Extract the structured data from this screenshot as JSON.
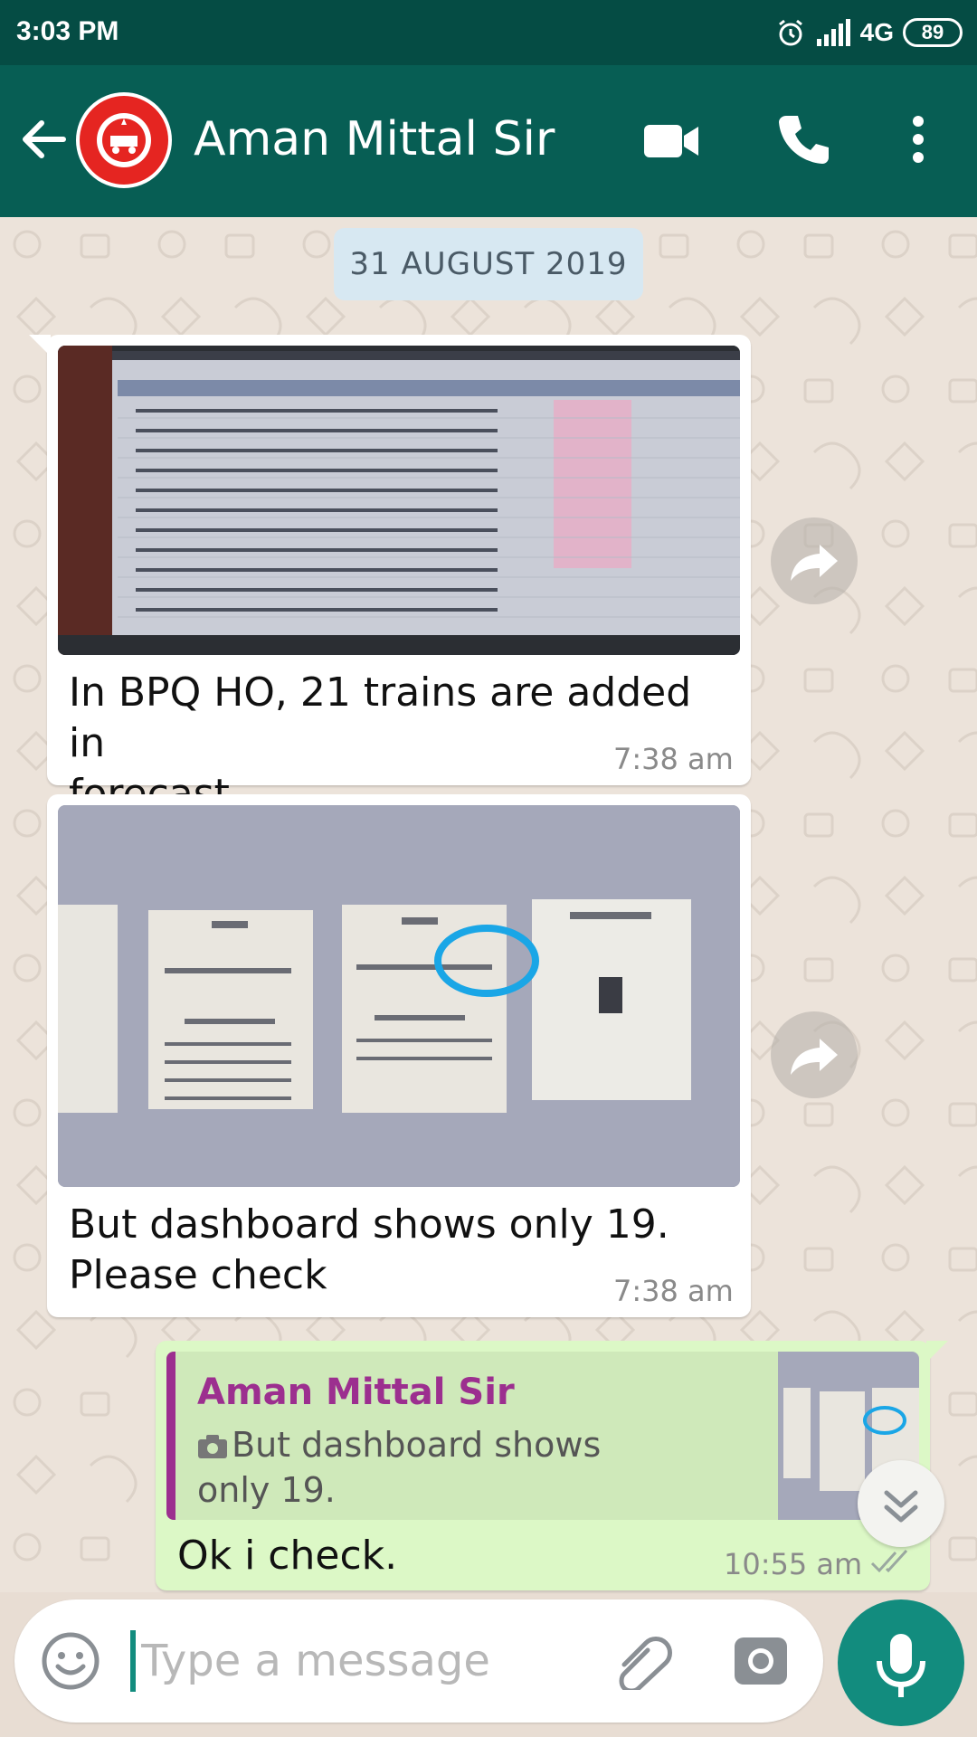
{
  "status_bar": {
    "time": "3:03 PM",
    "network": "4G",
    "battery": "89",
    "icons": [
      "alarm-icon",
      "signal-icon",
      "battery-icon"
    ]
  },
  "header": {
    "contact_name": "Aman Mittal Sir",
    "avatar_icon": "indian-railways-logo",
    "avatar_logo_text": "INDIAN RAILWAYS",
    "icons": [
      "back-arrow-icon",
      "video-call-icon",
      "phone-icon",
      "more-vert-icon"
    ]
  },
  "chat": {
    "date_divider": "31 AUGUST 2019",
    "messages": [
      {
        "direction": "incoming",
        "type": "image",
        "caption": "In BPQ HO, 21 trains are added in forecast",
        "caption_lines": [
          "In BPQ HO, 21 trains are added in",
          "forecast"
        ],
        "time": "7:38 am"
      },
      {
        "direction": "incoming",
        "type": "image",
        "caption": "But dashboard shows only 19. Please check",
        "caption_lines": [
          "But dashboard shows only 19.",
          "Please check"
        ],
        "time": "7:38 am"
      },
      {
        "direction": "outgoing",
        "type": "text",
        "reply_to": {
          "author": "Aman Mittal Sir",
          "text": "But dashboard shows only 19. Please check",
          "text_lines": [
            "But dashboard shows only 19.",
            "Please check"
          ],
          "icon": "camera-small-icon"
        },
        "text": "Ok i check.",
        "time": "10:55 am",
        "status": "delivered"
      }
    ]
  },
  "composer": {
    "placeholder": "Type a message",
    "icons": [
      "emoji-icon",
      "attach-icon",
      "camera-icon",
      "mic-icon"
    ]
  },
  "colors": {
    "status_bar": "#054c44",
    "header": "#075e54",
    "chat_bg": "#ece3da",
    "incoming_bubble": "#ffffff",
    "outgoing_bubble": "#dcf8c6",
    "accent": "#128c7e",
    "quote_author": "#9c2f8f"
  }
}
